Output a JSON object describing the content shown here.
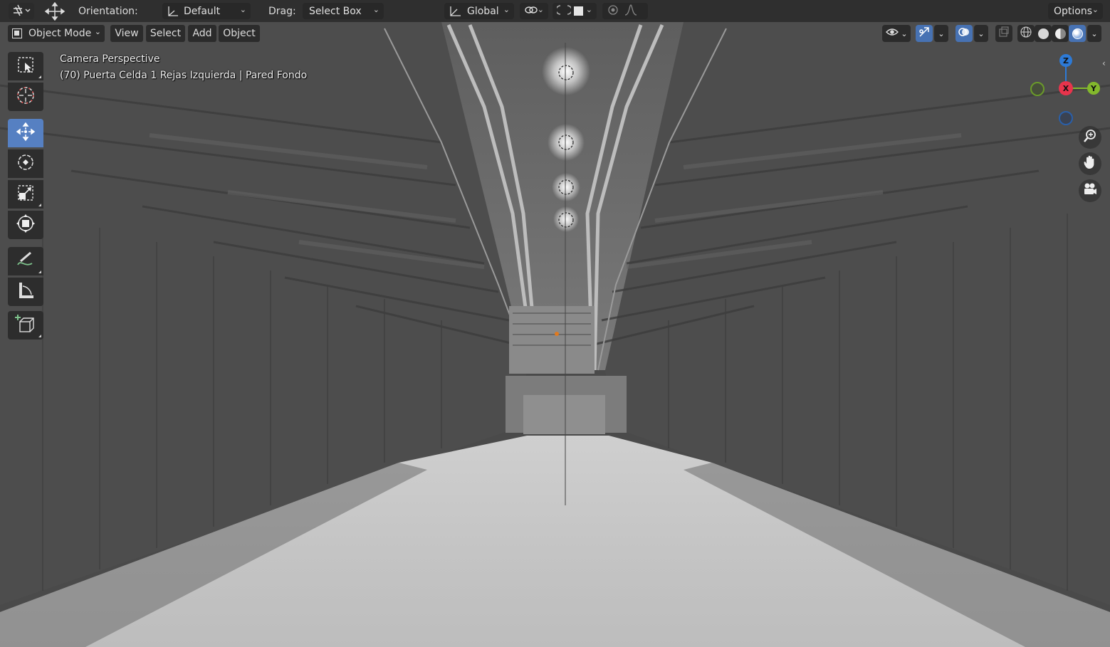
{
  "header": {
    "editor_type_icon": "editor-type-icon",
    "transform_icon": "move-arrows-icon",
    "orientation_label": "Orientation:",
    "orientation_value": "Default",
    "drag_label": "Drag:",
    "drag_value": "Select Box",
    "pivot_value": "Global",
    "options_label": "Options"
  },
  "menubar": {
    "mode": "Object Mode",
    "view": "View",
    "select": "Select",
    "add": "Add",
    "object": "Object"
  },
  "viewport": {
    "title": "Camera Perspective",
    "subtitle": "(70) Puerta Celda 1 Rejas Izquierda | Pared Fondo"
  },
  "gizmo": {
    "z": "Z",
    "x": "X",
    "y": "Y",
    "colors": {
      "x": "#e8344c",
      "y": "#83b82c",
      "z": "#2d7ad6"
    }
  },
  "toolbar": {
    "tools": [
      "select-box-icon",
      "cursor-icon",
      "move-icon",
      "rotate-icon",
      "scale-icon",
      "transform-icon",
      "annotate-icon",
      "measure-icon",
      "add-cube-icon"
    ],
    "active": "move-icon"
  },
  "colors": {
    "accent": "#4772b3",
    "header_bg": "#2f2f2f"
  }
}
